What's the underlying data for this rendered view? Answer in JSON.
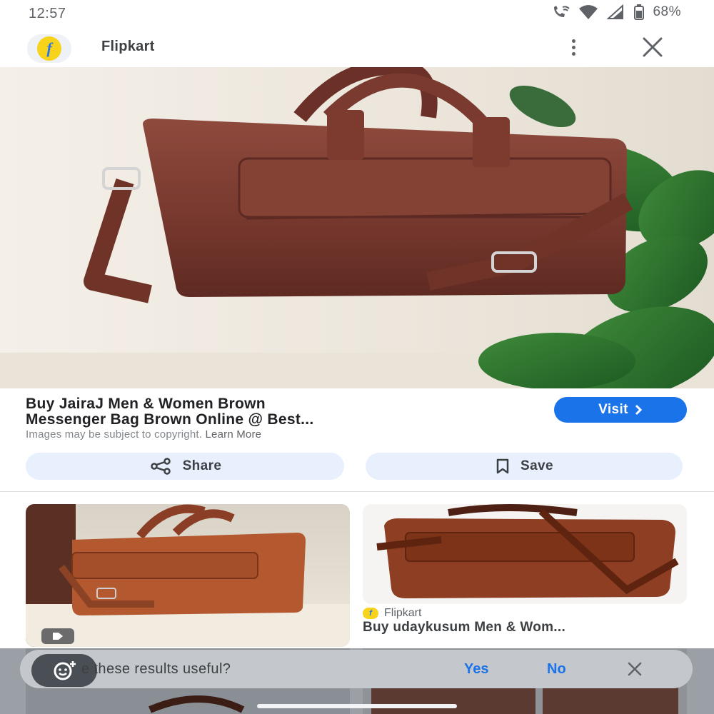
{
  "status_bar": {
    "time": "12:57",
    "battery": "68%"
  },
  "header": {
    "source_name": "Flipkart",
    "logo_letter": "f"
  },
  "result": {
    "title_line1": "Buy JairaJ Men & Women Brown",
    "title_line2": "Messenger Bag Brown Online @ Best...",
    "visit_label": "Visit",
    "copyright_text": "Images may be subject to copyright.",
    "learn_more": "Learn More",
    "share_label": "Share",
    "save_label": "Save"
  },
  "related": [
    {
      "source": "",
      "title": ""
    },
    {
      "source": "Flipkart",
      "title": "Buy udaykusum Men & Wom..."
    }
  ],
  "feedback": {
    "question": "e these results useful?",
    "yes_label": "Yes",
    "no_label": "No"
  },
  "colors": {
    "accent": "#1a73e8",
    "chip_bg": "#e8f0fe",
    "bag_brown": "#7b3a2e",
    "flipkart_yellow": "#f7d31b",
    "flipkart_blue": "#2874f0"
  },
  "icons": {
    "phone_wifi": "wifi-calling-icon",
    "wifi": "wifi-icon",
    "signal": "signal-icon",
    "battery": "battery-icon",
    "more": "more-vert-icon",
    "close": "close-icon",
    "share": "share-icon",
    "save": "bookmark-icon",
    "visit_arrow": "chevron-right-icon",
    "feedback": "feedback-face-icon"
  }
}
